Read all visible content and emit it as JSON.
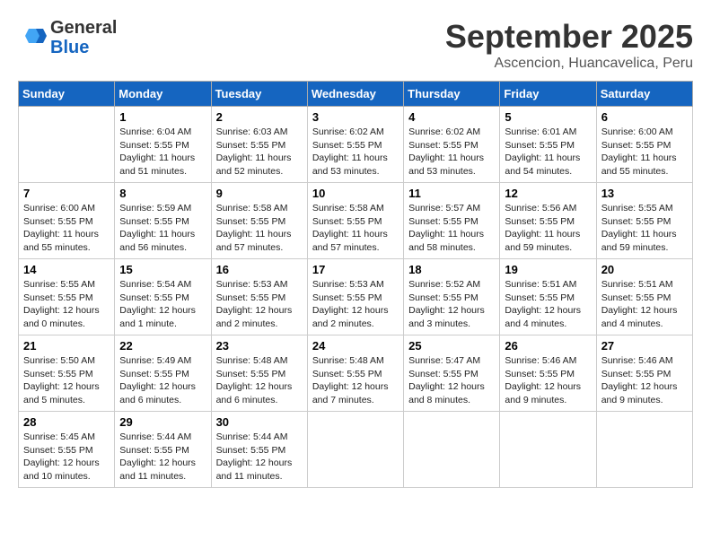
{
  "header": {
    "logo_general": "General",
    "logo_blue": "Blue",
    "month_title": "September 2025",
    "subtitle": "Ascencion, Huancavelica, Peru"
  },
  "days_of_week": [
    "Sunday",
    "Monday",
    "Tuesday",
    "Wednesday",
    "Thursday",
    "Friday",
    "Saturday"
  ],
  "weeks": [
    [
      {
        "day": "",
        "info": ""
      },
      {
        "day": "1",
        "info": "Sunrise: 6:04 AM\nSunset: 5:55 PM\nDaylight: 11 hours\nand 51 minutes."
      },
      {
        "day": "2",
        "info": "Sunrise: 6:03 AM\nSunset: 5:55 PM\nDaylight: 11 hours\nand 52 minutes."
      },
      {
        "day": "3",
        "info": "Sunrise: 6:02 AM\nSunset: 5:55 PM\nDaylight: 11 hours\nand 53 minutes."
      },
      {
        "day": "4",
        "info": "Sunrise: 6:02 AM\nSunset: 5:55 PM\nDaylight: 11 hours\nand 53 minutes."
      },
      {
        "day": "5",
        "info": "Sunrise: 6:01 AM\nSunset: 5:55 PM\nDaylight: 11 hours\nand 54 minutes."
      },
      {
        "day": "6",
        "info": "Sunrise: 6:00 AM\nSunset: 5:55 PM\nDaylight: 11 hours\nand 55 minutes."
      }
    ],
    [
      {
        "day": "7",
        "info": "Sunrise: 6:00 AM\nSunset: 5:55 PM\nDaylight: 11 hours\nand 55 minutes."
      },
      {
        "day": "8",
        "info": "Sunrise: 5:59 AM\nSunset: 5:55 PM\nDaylight: 11 hours\nand 56 minutes."
      },
      {
        "day": "9",
        "info": "Sunrise: 5:58 AM\nSunset: 5:55 PM\nDaylight: 11 hours\nand 57 minutes."
      },
      {
        "day": "10",
        "info": "Sunrise: 5:58 AM\nSunset: 5:55 PM\nDaylight: 11 hours\nand 57 minutes."
      },
      {
        "day": "11",
        "info": "Sunrise: 5:57 AM\nSunset: 5:55 PM\nDaylight: 11 hours\nand 58 minutes."
      },
      {
        "day": "12",
        "info": "Sunrise: 5:56 AM\nSunset: 5:55 PM\nDaylight: 11 hours\nand 59 minutes."
      },
      {
        "day": "13",
        "info": "Sunrise: 5:55 AM\nSunset: 5:55 PM\nDaylight: 11 hours\nand 59 minutes."
      }
    ],
    [
      {
        "day": "14",
        "info": "Sunrise: 5:55 AM\nSunset: 5:55 PM\nDaylight: 12 hours\nand 0 minutes."
      },
      {
        "day": "15",
        "info": "Sunrise: 5:54 AM\nSunset: 5:55 PM\nDaylight: 12 hours\nand 1 minute."
      },
      {
        "day": "16",
        "info": "Sunrise: 5:53 AM\nSunset: 5:55 PM\nDaylight: 12 hours\nand 2 minutes."
      },
      {
        "day": "17",
        "info": "Sunrise: 5:53 AM\nSunset: 5:55 PM\nDaylight: 12 hours\nand 2 minutes."
      },
      {
        "day": "18",
        "info": "Sunrise: 5:52 AM\nSunset: 5:55 PM\nDaylight: 12 hours\nand 3 minutes."
      },
      {
        "day": "19",
        "info": "Sunrise: 5:51 AM\nSunset: 5:55 PM\nDaylight: 12 hours\nand 4 minutes."
      },
      {
        "day": "20",
        "info": "Sunrise: 5:51 AM\nSunset: 5:55 PM\nDaylight: 12 hours\nand 4 minutes."
      }
    ],
    [
      {
        "day": "21",
        "info": "Sunrise: 5:50 AM\nSunset: 5:55 PM\nDaylight: 12 hours\nand 5 minutes."
      },
      {
        "day": "22",
        "info": "Sunrise: 5:49 AM\nSunset: 5:55 PM\nDaylight: 12 hours\nand 6 minutes."
      },
      {
        "day": "23",
        "info": "Sunrise: 5:48 AM\nSunset: 5:55 PM\nDaylight: 12 hours\nand 6 minutes."
      },
      {
        "day": "24",
        "info": "Sunrise: 5:48 AM\nSunset: 5:55 PM\nDaylight: 12 hours\nand 7 minutes."
      },
      {
        "day": "25",
        "info": "Sunrise: 5:47 AM\nSunset: 5:55 PM\nDaylight: 12 hours\nand 8 minutes."
      },
      {
        "day": "26",
        "info": "Sunrise: 5:46 AM\nSunset: 5:55 PM\nDaylight: 12 hours\nand 9 minutes."
      },
      {
        "day": "27",
        "info": "Sunrise: 5:46 AM\nSunset: 5:55 PM\nDaylight: 12 hours\nand 9 minutes."
      }
    ],
    [
      {
        "day": "28",
        "info": "Sunrise: 5:45 AM\nSunset: 5:55 PM\nDaylight: 12 hours\nand 10 minutes."
      },
      {
        "day": "29",
        "info": "Sunrise: 5:44 AM\nSunset: 5:55 PM\nDaylight: 12 hours\nand 11 minutes."
      },
      {
        "day": "30",
        "info": "Sunrise: 5:44 AM\nSunset: 5:55 PM\nDaylight: 12 hours\nand 11 minutes."
      },
      {
        "day": "",
        "info": ""
      },
      {
        "day": "",
        "info": ""
      },
      {
        "day": "",
        "info": ""
      },
      {
        "day": "",
        "info": ""
      }
    ]
  ]
}
